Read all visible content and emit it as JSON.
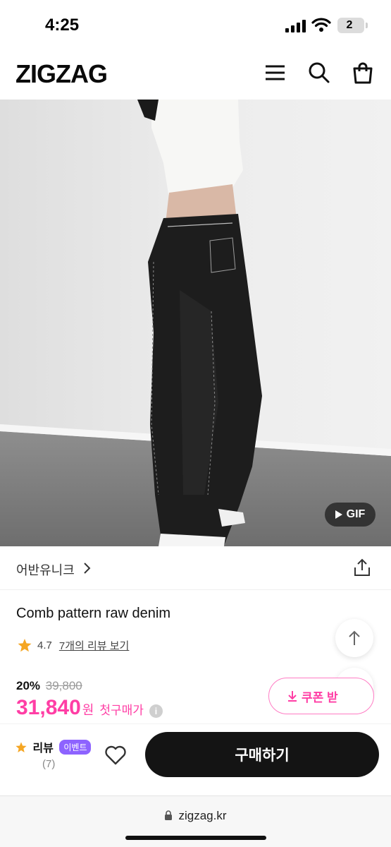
{
  "status_bar": {
    "time": "4:25",
    "battery": "2"
  },
  "header": {
    "logo": "ZIGZAG",
    "icons": [
      "menu-icon",
      "search-icon",
      "shopping-bag-icon"
    ]
  },
  "product_image": {
    "gif_badge": "GIF"
  },
  "brand": {
    "name": "어반유니크"
  },
  "product": {
    "title": "Comb pattern raw denim",
    "rating": "4.7",
    "review_link": "7개의 리뷰 보기"
  },
  "price": {
    "discount_rate": "20%",
    "original": "39,800",
    "final": "31,840",
    "currency": "원",
    "first_purchase_label": "첫구매가"
  },
  "coupon": {
    "label": "쿠폰 받"
  },
  "bottom_bar": {
    "review_label": "리뷰",
    "event_badge": "이벤트",
    "review_count": "(7)",
    "buy_label": "구매하기"
  },
  "browser": {
    "url": "zigzag.kr"
  },
  "colors": {
    "accent_pink": "#ff3ea5",
    "event_purple": "#8d63ff",
    "buy_button": "#141414",
    "star": "#f5a623"
  }
}
